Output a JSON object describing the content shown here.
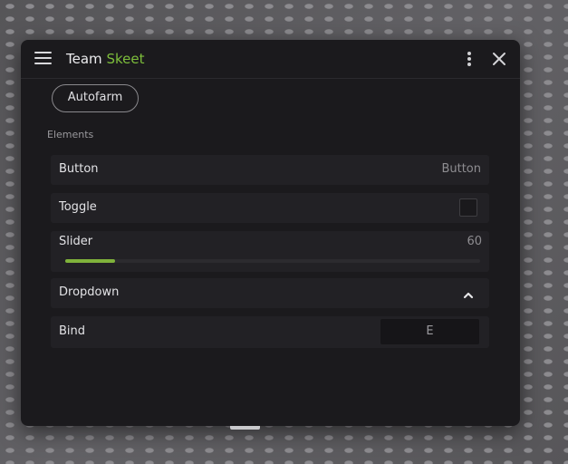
{
  "window": {
    "title_prefix": "Team",
    "title_accent": "Skeet",
    "accent_color": "#7dbd3b"
  },
  "icons": {
    "menu": "hamburger-icon",
    "more": "kebab-icon",
    "close": "close-icon",
    "dropdown": "chevron-up-icon"
  },
  "tabs": [
    {
      "label": "Autofarm",
      "active": true
    }
  ],
  "section": {
    "label": "Elements"
  },
  "elements": {
    "button": {
      "label": "Button",
      "value": "Button"
    },
    "toggle": {
      "label": "Toggle",
      "checked": false
    },
    "slider": {
      "label": "Slider",
      "value": "60",
      "fill_fraction": 0.12,
      "fill_color": "#7fb23b"
    },
    "dropdown": {
      "label": "Dropdown",
      "expanded": true
    },
    "bind": {
      "label": "Bind",
      "key": "E"
    }
  }
}
